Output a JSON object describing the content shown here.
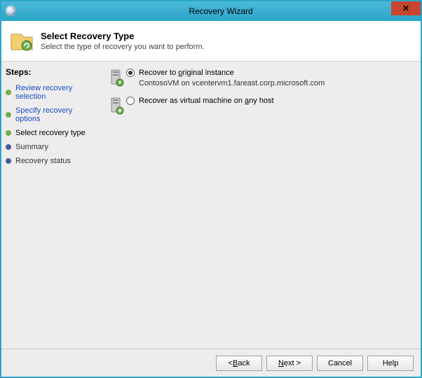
{
  "window": {
    "title": "Recovery Wizard"
  },
  "header": {
    "title": "Select Recovery Type",
    "subtitle": "Select the type of recovery you want to perform."
  },
  "sidebar": {
    "steps_label": "Steps:",
    "items": [
      {
        "label": "Review recovery selection",
        "state": "done",
        "link": true
      },
      {
        "label": "Specify recovery options",
        "state": "done",
        "link": true
      },
      {
        "label": "Select recovery type",
        "state": "current",
        "link": false
      },
      {
        "label": "Summary",
        "state": "pending",
        "link": false
      },
      {
        "label": "Recovery status",
        "state": "pending",
        "link": false
      }
    ]
  },
  "options": {
    "original": {
      "label_pre": "Recover to ",
      "label_hot": "o",
      "label_post": "riginal instance",
      "detail": "ContosoVM on vcentervm1.fareast.corp.microsoft.com",
      "selected": true
    },
    "anyhost": {
      "label_pre": "Recover as virtual machine on ",
      "label_hot": "a",
      "label_post": "ny host",
      "selected": false
    }
  },
  "footer": {
    "back_pre": "< ",
    "back_hot": "B",
    "back_post": "ack",
    "next_pre": "",
    "next_hot": "N",
    "next_post": "ext >",
    "cancel": "Cancel",
    "help": "Help"
  }
}
